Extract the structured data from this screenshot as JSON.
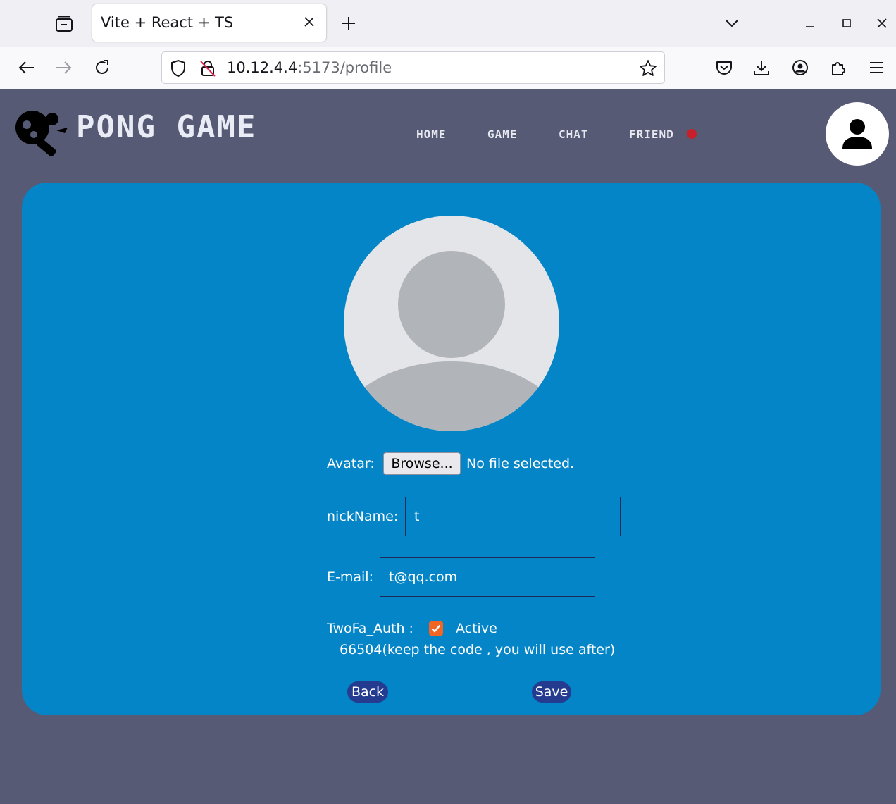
{
  "browser": {
    "tab_title": "Vite + React + TS",
    "url_host": "10.12.4.4",
    "url_path": ":5173/profile"
  },
  "header": {
    "brand": "PONG GAME",
    "nav": [
      "HOME",
      "GAME",
      "CHAT",
      "FRIEND"
    ],
    "friend_notification": true
  },
  "profile_form": {
    "avatar_label": "Avatar:",
    "browse_label": "Browse...",
    "file_status": "No file selected.",
    "nickname_label": "nickName:",
    "nickname_value": "t",
    "email_label": "E-mail:",
    "email_value": "t@qq.com",
    "twofa_label": "TwoFa_Auth :",
    "twofa_checked": true,
    "twofa_status": "Active",
    "twofa_code_note": "66504(keep the code , you will use after)",
    "back_label": "Back",
    "save_label": "Save"
  },
  "colors": {
    "page_bg": "#575a75",
    "card_bg": "#0385c8",
    "button_bg": "#243b8f",
    "checkbox": "#f26522",
    "notification_dot": "#c8202a"
  }
}
